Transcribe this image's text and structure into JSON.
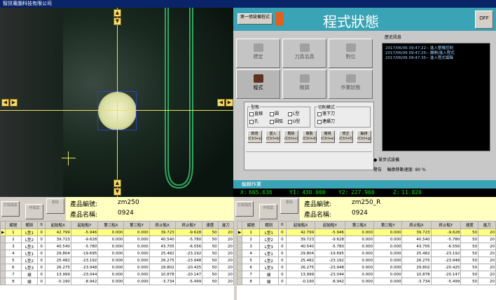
{
  "window": {
    "title": "智訊電腦科技有限公司"
  },
  "right_panel": {
    "top_button": "第一張設備程式",
    "title": "程式狀態",
    "off_label": "OFF",
    "tiles": [
      "標定",
      "刀具治具",
      "對位",
      "程式",
      "微調",
      "作業狀態"
    ],
    "history_label": "歷史訊息",
    "history": [
      "2017/06/06 09:47:22-- 進入整機控制",
      "2017/06/06 09:47:25-- 離開/進入程式",
      "2017/06/06 09:47:35-- 進入程式編輯"
    ],
    "dialog": {
      "group1_title": "型態",
      "group1_options": [
        "直線",
        "圓",
        "L型",
        "孔",
        "圓弧",
        "U型"
      ],
      "group2_title": "切削模式",
      "group2_options": [
        "落下刀",
        "連續刀"
      ],
      "buttons": [
        {
          "label": "新增",
          "key": "(Ctrl+a)"
        },
        {
          "label": "插入",
          "key": "(Ctrl+b)"
        },
        {
          "label": "刪除",
          "key": "(Ctrl+c)"
        },
        {
          "label": "複製",
          "key": "(Ctrl+d)"
        },
        {
          "label": "複視",
          "key": "(Ctrl+e)"
        },
        {
          "label": "修正",
          "key": "(Ctrl+f)"
        },
        {
          "label": "編排",
          "key": "(Ctrl+g)"
        }
      ]
    },
    "option1": "單步式設備",
    "option2_label": "警告",
    "option2_value": "輪廓移動速度: 80 %",
    "edit_bar": "編輯作業"
  },
  "coords": {
    "x_label": "X:",
    "x": "665.636",
    "y1_label": "Y1:",
    "y1": "430.000",
    "y2_label": "Y2:",
    "y2": "227.960",
    "z_label": "Z:",
    "z": "11.820"
  },
  "left_info": {
    "btn1": "打開檔案",
    "btn2": "存檔案",
    "btn3": "刪除",
    "code_label": "產品編號:",
    "code": "zm250",
    "name_label": "產品名稱:",
    "name": "0924"
  },
  "right_info": {
    "btn1": "打開檔案",
    "btn2": "存檔案",
    "btn3": "刪除",
    "code_label": "產品編號:",
    "code": "zm250_R",
    "name_label": "產品名稱:",
    "name": "0924"
  },
  "table_headers": [
    "編號",
    "類別",
    "0",
    "起始點X",
    "起始點Y",
    "第二點X",
    "第二點Y",
    "終止點X",
    "終止點Y",
    "速度",
    "進刀"
  ],
  "left_rows": [
    [
      "1",
      "L型1",
      "0",
      "42.799",
      "-5.946",
      "0.000",
      "0.000",
      "39.723",
      "-9.628",
      "50",
      "20"
    ],
    [
      "2",
      "L型2",
      "0",
      "39.723",
      "-9.628",
      "0.000",
      "0.000",
      "40.540",
      "-5.780",
      "50",
      "20"
    ],
    [
      "3",
      "L型3",
      "0",
      "40.540",
      "-5.780",
      "0.000",
      "0.000",
      "43.705",
      "-6.556",
      "50",
      "20"
    ],
    [
      "4",
      "L型1",
      "0",
      "29.804",
      "-19.695",
      "0.000",
      "0.000",
      "25.482",
      "-23.192",
      "50",
      "20"
    ],
    [
      "5",
      "L型2",
      "0",
      "25.482",
      "-23.192",
      "0.000",
      "0.000",
      "26.275",
      "-23.948",
      "50",
      "20"
    ],
    [
      "6",
      "L型3",
      "0",
      "26.275",
      "-23.948",
      "0.000",
      "0.000",
      "29.802",
      "-20.425",
      "50",
      "20"
    ],
    [
      "7",
      "線",
      "0",
      "13.999",
      "-23.044",
      "0.000",
      "0.000",
      "10.878",
      "-20.147",
      "50",
      "20"
    ],
    [
      "8",
      "線",
      "0",
      "-0.190",
      "-8.942",
      "0.000",
      "0.000",
      "-3.734",
      "-5.499",
      "50",
      "20"
    ]
  ],
  "right_rows": [
    [
      "1",
      "L型1",
      "0",
      "42.799",
      "-5.946",
      "0.000",
      "0.000",
      "39.723",
      "-9.628",
      "50",
      "20"
    ],
    [
      "2",
      "L型2",
      "0",
      "39.723",
      "-9.628",
      "0.000",
      "0.000",
      "40.540",
      "-5.780",
      "50",
      "20"
    ],
    [
      "3",
      "L型3",
      "0",
      "40.540",
      "-5.780",
      "0.000",
      "0.000",
      "43.705",
      "-6.556",
      "50",
      "20"
    ],
    [
      "4",
      "L型1",
      "0",
      "29.804",
      "-19.695",
      "0.000",
      "0.000",
      "25.482",
      "-23.192",
      "50",
      "20"
    ],
    [
      "5",
      "L型2",
      "0",
      "25.482",
      "-23.192",
      "0.000",
      "0.000",
      "26.275",
      "-23.948",
      "50",
      "20"
    ],
    [
      "6",
      "L型3",
      "0",
      "26.275",
      "-23.948",
      "0.000",
      "0.000",
      "29.802",
      "-20.425",
      "50",
      "20"
    ],
    [
      "7",
      "線",
      "0",
      "13.999",
      "-23.044",
      "0.000",
      "0.000",
      "10.878",
      "-20.147",
      "50",
      "20"
    ],
    [
      "8",
      "線",
      "0",
      "-0.190",
      "-8.942",
      "0.000",
      "0.000",
      "-3.734",
      "-5.499",
      "50",
      "20"
    ]
  ],
  "colors": {
    "accent": "#3aa3b5",
    "selected_row": "#ffff80",
    "coord_text": "#00e000"
  }
}
